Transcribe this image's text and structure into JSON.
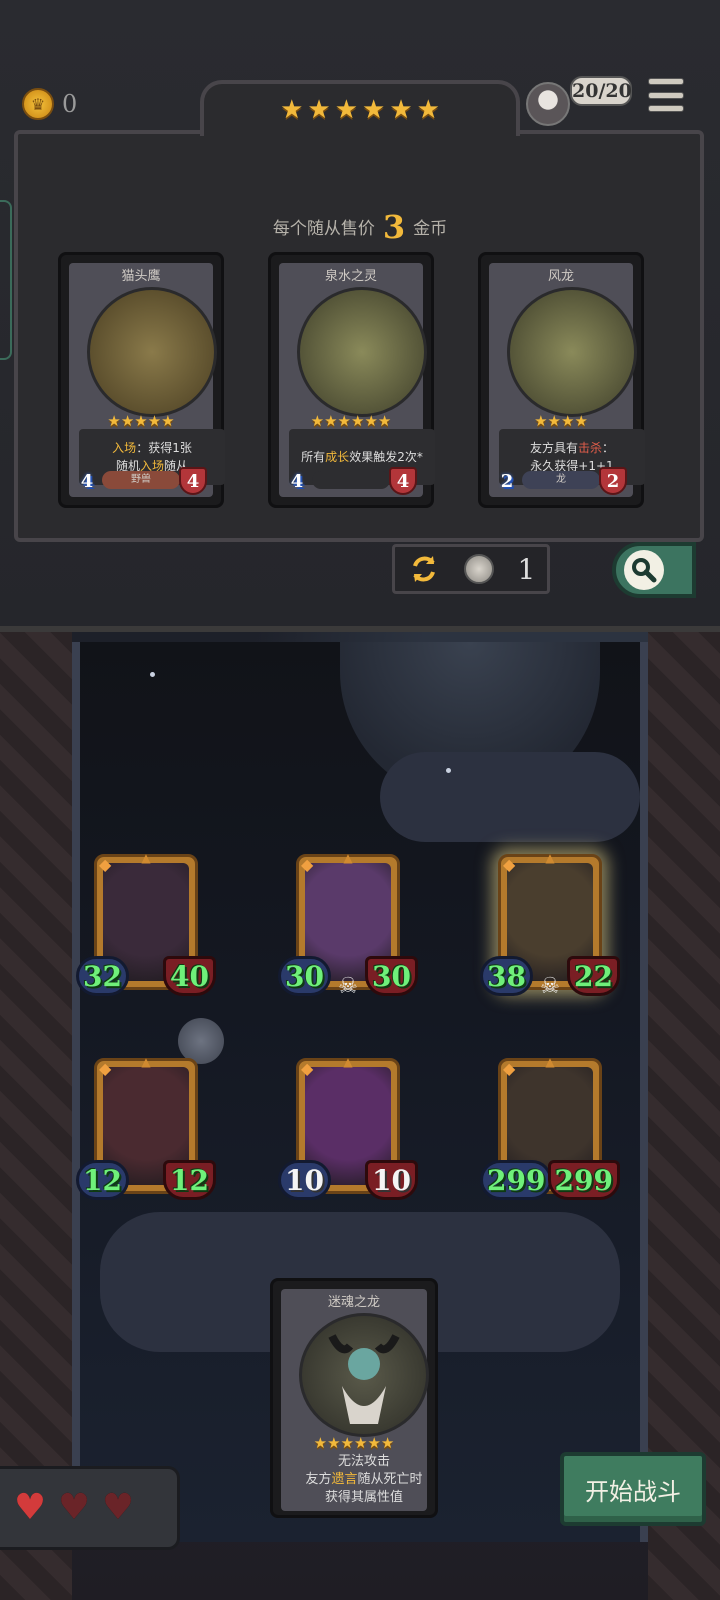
{
  "hud": {
    "gold": "0",
    "tier_stars": 6,
    "hero_health": "20/20"
  },
  "shop": {
    "price_prefix": "每个随从售价",
    "price_value": "3",
    "price_suffix": "金币",
    "cards": [
      {
        "name": "猫头鹰",
        "stars": 5,
        "desc_parts": [
          [
            "入场",
            "hl"
          ],
          [
            "：获得1张",
            ""
          ]
        ],
        "desc_line2": [
          [
            "随机",
            ""
          ],
          [
            "入场",
            "hl"
          ],
          [
            "随从",
            ""
          ]
        ],
        "attack": "4",
        "health": "4",
        "tribe": "野兽",
        "tribe_color": "#8a4a3a"
      },
      {
        "name": "泉水之灵",
        "stars": 6,
        "desc_parts": [
          [
            "所有",
            ""
          ],
          [
            "成长",
            "hl"
          ],
          [
            "效果触发2次*",
            ""
          ]
        ],
        "desc_line2": [],
        "attack": "4",
        "health": "4",
        "tribe": "",
        "tribe_color": "#2d2d30"
      },
      {
        "name": "风龙",
        "stars": 4,
        "desc_parts": [
          [
            "友方具有",
            ""
          ],
          [
            "击杀",
            "hl-red"
          ],
          [
            "：",
            ""
          ]
        ],
        "desc_line2": [
          [
            "永久获得+1+1",
            ""
          ]
        ],
        "attack": "2",
        "health": "2",
        "tribe": "龙",
        "tribe_color": "#3e4256"
      }
    ],
    "refresh_cost": "1"
  },
  "board": {
    "units": [
      {
        "attack": "32",
        "health": "40",
        "skull": false,
        "glow": false,
        "white": false,
        "art": "#3a2a3a"
      },
      {
        "attack": "30",
        "health": "30",
        "skull": true,
        "glow": false,
        "white": false,
        "art": "#5a3a6a"
      },
      {
        "attack": "38",
        "health": "22",
        "skull": true,
        "glow": true,
        "white": false,
        "art": "#4a3e2e"
      },
      {
        "attack": "12",
        "health": "12",
        "skull": false,
        "glow": false,
        "white": false,
        "art": "#4a2a30"
      },
      {
        "attack": "10",
        "health": "10",
        "skull": false,
        "glow": false,
        "white": true,
        "art": "#5a2e66"
      },
      {
        "attack": "299",
        "health": "299",
        "skull": false,
        "glow": false,
        "white": false,
        "art": "#3e342c"
      }
    ]
  },
  "hero_card": {
    "name": "迷魂之龙",
    "stars": 6,
    "line1": "无法攻击",
    "line2_parts": [
      [
        "友方",
        ""
      ],
      [
        "遗言",
        "hl"
      ],
      [
        "随从死亡时",
        ""
      ]
    ],
    "line3": "获得其属性值"
  },
  "lives": {
    "full": 1,
    "total": 3
  },
  "start_button": "开始战斗",
  "colors": {
    "gold": "#f2b93b",
    "green_stat": "#6ff07a",
    "button_green": "#3f7c5f"
  }
}
